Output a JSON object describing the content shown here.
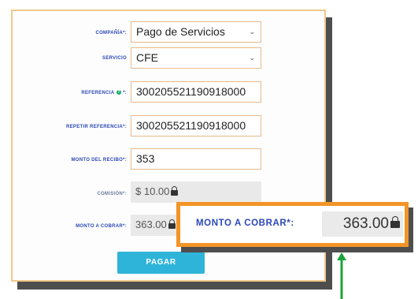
{
  "form": {
    "company": {
      "label": "COMPAÑÍA*:",
      "value": "Pago de Servicios"
    },
    "service": {
      "label": "SERVICIO",
      "value": "CFE"
    },
    "reference": {
      "label": "REFERENCIA",
      "help_icon": "question-circle-icon",
      "label_suffix": "*:",
      "value": "300205521190918000"
    },
    "repeat_reference": {
      "label": "REPETIR REFERENCIA*:",
      "value": "300205521190918000"
    },
    "receipt_amount": {
      "label": "MONTO DEL RECIBO*:",
      "value": "353"
    },
    "commission": {
      "label": "COMISIÓN*:",
      "value": "$ 10.00",
      "icon": "lock-icon"
    },
    "amount_to_charge": {
      "label": "MONTO A COBRAR*:",
      "value": "363.00",
      "icon": "lock-icon"
    },
    "pay_button": {
      "label": "PAGAR"
    }
  },
  "callout": {
    "label": "MONTO A COBRAR*:",
    "value": "363.00",
    "icon": "lock-icon",
    "border_color": "#f39426",
    "arrow_color": "#1aa33a"
  },
  "colors": {
    "label_blue": "#2a47b8",
    "button": "#2fb4d9",
    "field_border": "#e7b98c",
    "card_border": "#f2c98a"
  }
}
